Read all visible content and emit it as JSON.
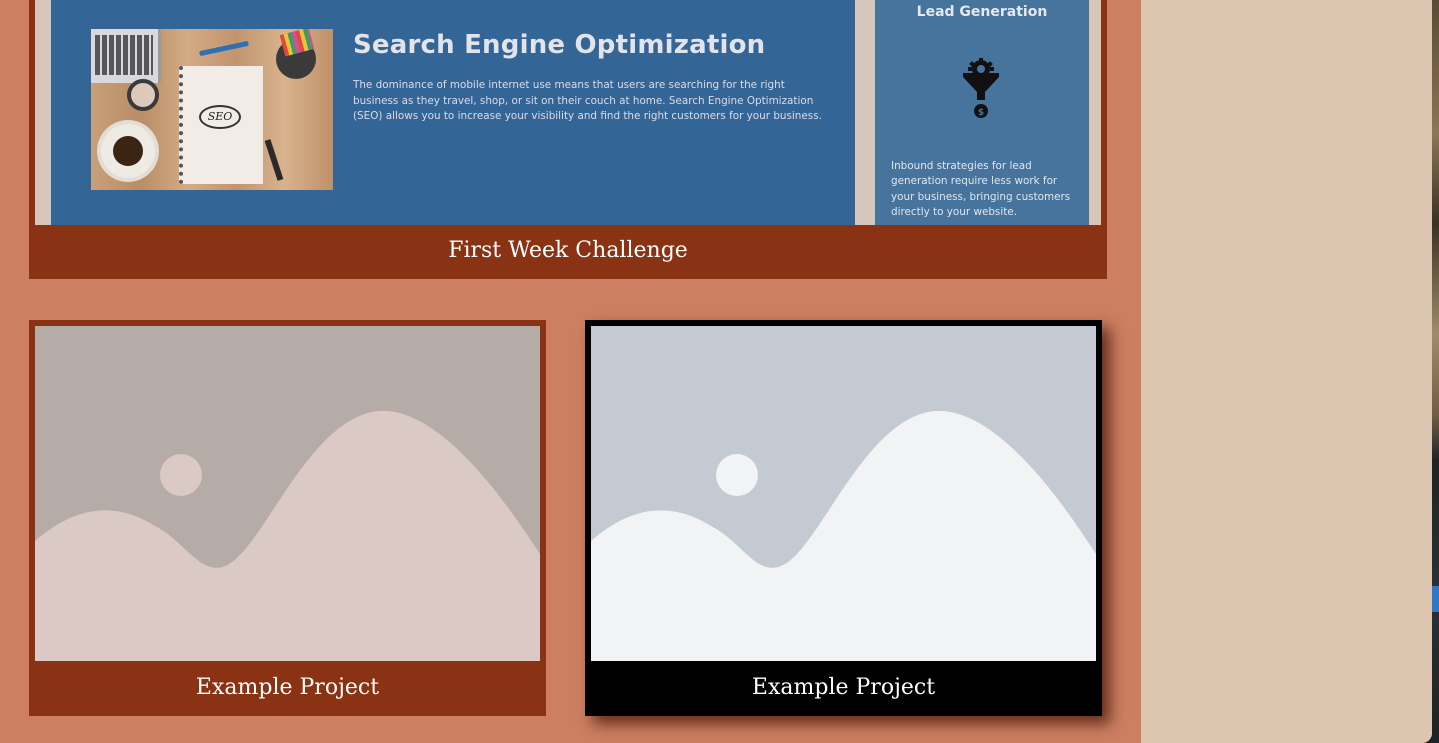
{
  "featured": {
    "seo_title": "Search Engine Optimization",
    "seo_body": "The dominance of mobile internet use means that users are searching for the right business as they travel, shop, or sit on their couch at home. Search Engine Optimization (SEO) allows you to increase your visibility and find the right customers for your business.",
    "seo_image_label": "SEO",
    "lead_title": "Lead Generation",
    "lead_icon": "funnel-gear-dollar-icon",
    "lead_body": "Inbound strategies for lead generation require less work for your business, bringing customers directly to your website.",
    "caption": "First Week Challenge"
  },
  "projects": [
    {
      "caption": "Example Project",
      "placeholder_icon": "image-placeholder-icon"
    },
    {
      "caption": "Example Project",
      "placeholder_icon": "image-placeholder-icon"
    }
  ],
  "colors": {
    "page_bg": "#cd7f62",
    "sidebar_bg": "#dcc6b1",
    "card_frame": "#8a3214",
    "card_frame_selected": "#000000",
    "seo_panel": "#346597",
    "lead_panel": "#46749c"
  }
}
